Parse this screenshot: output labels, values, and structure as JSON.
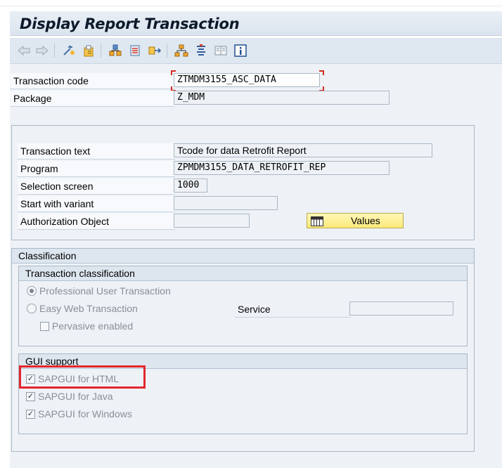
{
  "screen": {
    "title": "Display Report Transaction"
  },
  "toolbar": {
    "icons": [
      "back-arrow-icon",
      "forward-arrow-icon",
      "other-object-icon",
      "display-change-icon",
      "where-used-icon",
      "transport-icon",
      "navigation-icon",
      "hierarchy-icon",
      "documentation-icon",
      "layout-icon",
      "info-icon"
    ]
  },
  "header_fields": {
    "transaction_code": {
      "label": "Transaction code",
      "value": "ZTMDM3155_ASC_DATA"
    },
    "package": {
      "label": "Package",
      "value": "Z_MDM"
    }
  },
  "details": {
    "transaction_text": {
      "label": "Transaction text",
      "value": "Tcode for data Retrofit Report"
    },
    "program": {
      "label": "Program",
      "value": "ZPMDM3155_DATA_RETROFIT_REP"
    },
    "selection_screen": {
      "label": "Selection screen",
      "value": "1000"
    },
    "start_with_variant": {
      "label": "Start with variant",
      "value": ""
    },
    "authorization_object": {
      "label": "Authorization Object",
      "value": ""
    },
    "values_button": "Values"
  },
  "classification": {
    "title": "Classification",
    "transaction_classification": {
      "title": "Transaction classification",
      "professional": "Professional User Transaction",
      "easy_web": "Easy Web Transaction",
      "service_label": "Service",
      "service_value": "",
      "pervasive": "Pervasive enabled"
    },
    "gui_support": {
      "title": "GUI support",
      "html": "SAPGUI for HTML",
      "java": "SAPGUI for Java",
      "windows": "SAPGUI for Windows"
    }
  },
  "colors": {
    "highlight": "#e3262d",
    "button": "#fbe979",
    "background": "#eef2f7"
  }
}
